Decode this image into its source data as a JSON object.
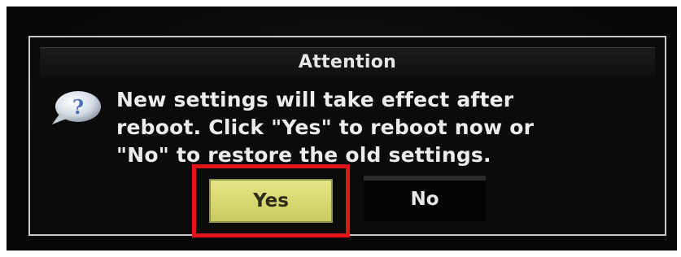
{
  "dialog": {
    "title": "Attention",
    "icon": "question-bubble-icon",
    "message": "New settings will take effect after\nreboot. Click \"Yes\" to reboot now or\n\"No\" to restore the old settings.",
    "buttons": {
      "yes_label": "Yes",
      "no_label": "No"
    },
    "highlighted_button": "Yes"
  },
  "colors": {
    "background": "#070707",
    "dialog_border": "#c9c9c9",
    "yes_button": "#d9da70",
    "highlight_box": "#e3141a",
    "text": "#ececec"
  }
}
